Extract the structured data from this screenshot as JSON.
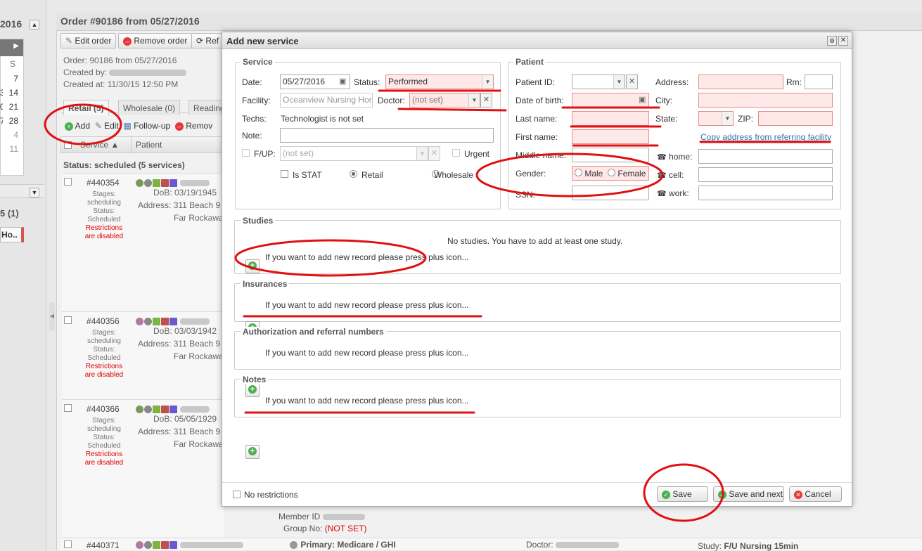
{
  "left": {
    "year": "2016",
    "cal_header": "S",
    "cal_days": [
      "7",
      "14",
      "21",
      "28",
      "4",
      "11"
    ],
    "cal_left": [
      "3",
      "0",
      "7"
    ],
    "section": "5 (1)",
    "item": "Ho.."
  },
  "order": {
    "title": "Order #90186 from 05/27/2016",
    "toolbar": {
      "edit": "Edit order",
      "remove": "Remove order",
      "refresh": "Ref"
    },
    "info": {
      "line1": "Order: 90186 from 05/27/2016",
      "created_by": "Created by:",
      "created_at": "Created at: 11/30/15 12:50 PM"
    },
    "tabs": [
      "Retail (5)",
      "Wholesale (0)",
      "Reading"
    ],
    "actions": {
      "add": "Add",
      "edit": "Edit",
      "followup": "Follow-up",
      "remove": "Remov"
    },
    "columns": {
      "service": "Service",
      "patient": "Patient"
    },
    "status_line": "Status: scheduled (5 services)",
    "rows": [
      {
        "num": "#440354",
        "stages_lbl": "Stages:",
        "stages": "scheduling",
        "status_lbl": "Status:",
        "status": "Scheduled",
        "restr1": "Restrictions",
        "restr2": "are disabled",
        "dob": "DoB: 03/19/1945",
        "addr": "Address: 311 Beach 9",
        "city": "Far Rockawa"
      },
      {
        "num": "#440356",
        "stages_lbl": "Stages:",
        "stages": "scheduling",
        "status_lbl": "Status:",
        "status": "Scheduled",
        "restr1": "Restrictions",
        "restr2": "are disabled",
        "dob": "DoB: 03/03/1942",
        "addr": "Address: 311 Beach 9",
        "city": "Far Rockawa"
      },
      {
        "num": "#440366",
        "stages_lbl": "Stages:",
        "stages": "scheduling",
        "status_lbl": "Status:",
        "status": "Scheduled",
        "restr1": "Restrictions",
        "restr2": "are disabled",
        "dob": "DoB: 05/05/1929",
        "addr": "Address: 311 Beach 9",
        "city": "Far Rockawa"
      }
    ],
    "bottom": {
      "member_id": "Member ID",
      "group_no": "Group No:",
      "not_set": "(NOT SET)",
      "row_num": "#440371",
      "primary": "Primary: Medicare / GHI",
      "doctor": "Doctor:",
      "study": "Study:",
      "study_val": "F/U Nursing 15min"
    }
  },
  "dialog": {
    "title": "Add new service",
    "service": {
      "legend": "Service",
      "date_lbl": "Date:",
      "date": "05/27/2016",
      "status_lbl": "Status:",
      "status": "Performed",
      "facility_lbl": "Facility:",
      "facility_ph": "Oceanview Nursing Hor",
      "doctor_lbl": "Doctor:",
      "doctor": "(not set)",
      "techs_lbl": "Techs:",
      "techs": "Technologist is not set",
      "note_lbl": "Note:",
      "fup_lbl": "F/UP:",
      "fup": "(not set)",
      "urgent": "Urgent",
      "is_stat": "Is STAT",
      "retail": "Retail",
      "wholesale": "Wholesale"
    },
    "patient": {
      "legend": "Patient",
      "id_lbl": "Patient ID:",
      "dob_lbl": "Date of birth:",
      "last_lbl": "Last name:",
      "first_lbl": "First name:",
      "middle_lbl": "Middle name:",
      "gender_lbl": "Gender:",
      "male": "Male",
      "female": "Female",
      "ssn_lbl": "SSN:",
      "address_lbl": "Address:",
      "rm_lbl": "Rm:",
      "city_lbl": "City:",
      "state_lbl": "State:",
      "zip_lbl": "ZIP:",
      "copy_link": "Copy address from referring facility",
      "home_lbl": "home:",
      "cell_lbl": "cell:",
      "work_lbl": "work:"
    },
    "studies": {
      "legend": "Studies",
      "error": "No studies. You have to add at least one study.",
      "hint": "If you want to add new record please press plus icon..."
    },
    "insurances": {
      "legend": "Insurances",
      "hint": "If you want to add new record please press plus icon..."
    },
    "auth": {
      "legend": "Authorization and referral numbers",
      "hint": "If you want to add new record please press plus icon..."
    },
    "notes": {
      "legend": "Notes",
      "hint": "If you want to add new record please press plus icon..."
    },
    "footer": {
      "no_restrictions": "No restrictions",
      "save": "Save",
      "save_next": "Save and next",
      "cancel": "Cancel"
    }
  },
  "colors": {
    "annotation": "#e01010",
    "error_bg": "#ffe8e8",
    "accent_green": "#4caf50"
  }
}
